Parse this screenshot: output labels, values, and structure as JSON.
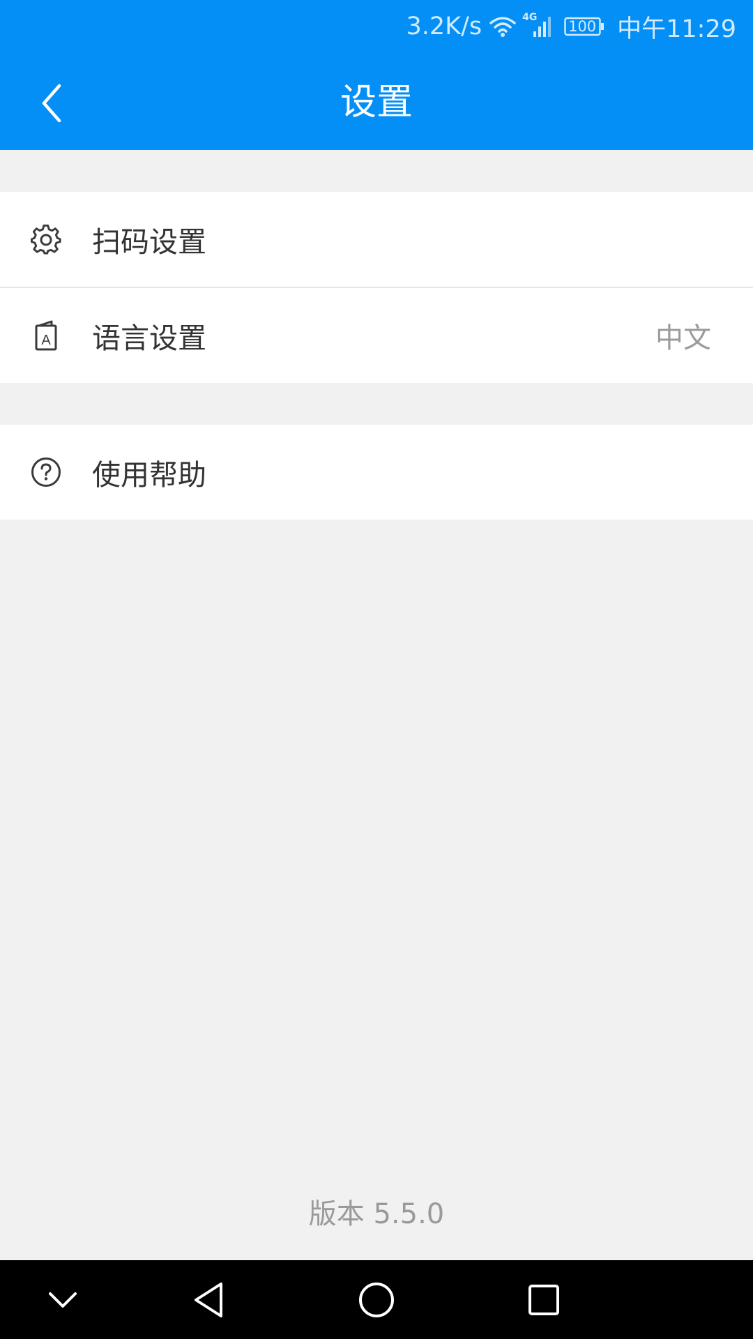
{
  "status_bar": {
    "speed": "3.2K/s",
    "network": "4G",
    "battery": "100",
    "time": "中午11:29",
    "icons": [
      "wifi-icon",
      "signal-icon",
      "battery-icon"
    ]
  },
  "header": {
    "title": "设置",
    "back_icon": "chevron-left-icon"
  },
  "settings": {
    "group1": [
      {
        "icon": "gear-icon",
        "label": "扫码设置",
        "value": ""
      },
      {
        "icon": "language-icon",
        "label": "语言设置",
        "value": "中文"
      }
    ],
    "group2": [
      {
        "icon": "help-circle-icon",
        "label": "使用帮助",
        "value": ""
      }
    ]
  },
  "footer": {
    "version": "版本 5.5.0"
  },
  "nav_bar": {
    "icons": [
      "chevron-down-icon",
      "back-triangle-icon",
      "home-circle-icon",
      "recents-square-icon"
    ]
  },
  "colors": {
    "accent": "#048ff6",
    "background": "#f1f1f1",
    "nav": "#000000"
  }
}
